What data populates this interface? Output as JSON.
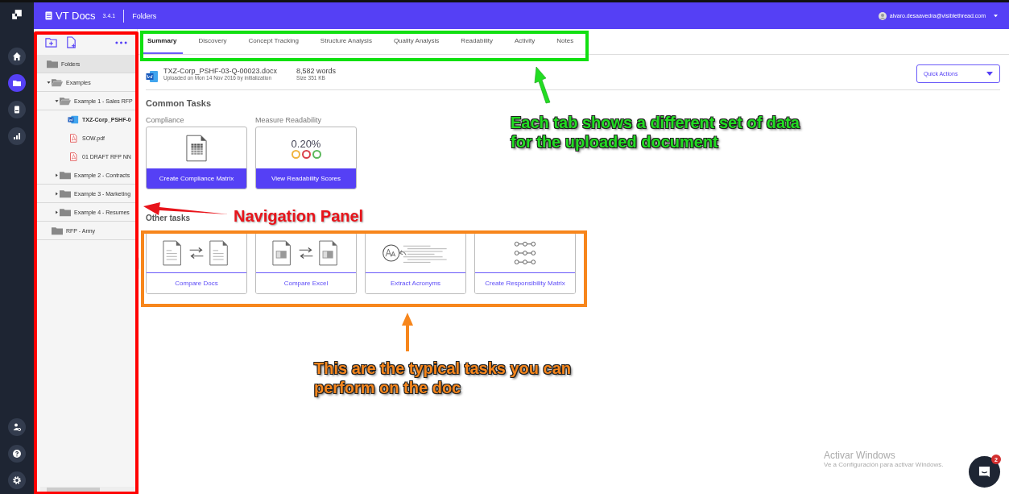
{
  "app": {
    "product": "VT Docs",
    "version": "3.4.1",
    "section": "Folders",
    "user": "alvaro.desaavedra@visiblethread.com"
  },
  "rail": {
    "items": [
      {
        "kind": "home",
        "selected": false
      },
      {
        "kind": "folder",
        "selected": true
      },
      {
        "kind": "document",
        "selected": false
      },
      {
        "kind": "chart",
        "selected": false
      }
    ],
    "bottom_items": [
      {
        "kind": "user-settings"
      },
      {
        "kind": "help"
      },
      {
        "kind": "settings"
      }
    ]
  },
  "navigation": {
    "tree": [
      {
        "kind": "folder",
        "label": "Folders",
        "selected": false,
        "children": [
          {
            "kind": "folder",
            "label": "Examples",
            "expanded": true,
            "selected": false,
            "children": [
              {
                "kind": "folder",
                "label": "Example 1 - Sales RFP",
                "expanded": true,
                "selected": false,
                "children": [
                  {
                    "kind": "word",
                    "label": "TXZ-Corp_PSHF-0",
                    "selected": true
                  },
                  {
                    "kind": "pdf",
                    "label": "SOW.pdf",
                    "selected": false
                  },
                  {
                    "kind": "pdf",
                    "label": "01 DRAFT RFP NN",
                    "selected": false
                  }
                ]
              },
              {
                "kind": "folder",
                "label": "Example 2 - Contracts",
                "expanded": false,
                "selected": false
              },
              {
                "kind": "folder",
                "label": "Example 3 - Marketing",
                "expanded": false,
                "selected": false
              },
              {
                "kind": "folder",
                "label": "Example 4 - Resumes",
                "expanded": false,
                "selected": false
              }
            ]
          },
          {
            "kind": "folder",
            "label": "RFP - Army",
            "selected": false
          }
        ]
      }
    ]
  },
  "tabs": [
    {
      "label": "Summary",
      "selected": true
    },
    {
      "label": "Discovery",
      "selected": false
    },
    {
      "label": "Concept Tracking",
      "selected": false
    },
    {
      "label": "Structure Analysis",
      "selected": false
    },
    {
      "label": "Quality Analysis",
      "selected": false
    },
    {
      "label": "Readability",
      "selected": false
    },
    {
      "label": "Activity",
      "selected": false
    },
    {
      "label": "Notes",
      "selected": false
    }
  ],
  "document": {
    "name": "TXZ-Corp_PSHF-03-Q-00023.docx",
    "uploaded": "Uploaded on Mon 14 Nov 2016 by initialization",
    "words": "8,582 words",
    "size": "Size 351 KB"
  },
  "quick_actions": {
    "label": "Quick Actions"
  },
  "common_tasks": {
    "title": "Common Tasks",
    "cards": [
      {
        "kind": "compliance",
        "caption": "Compliance",
        "button": "Create Compliance Matrix"
      },
      {
        "kind": "readability",
        "caption": "Measure Readability",
        "reading": "0.20%",
        "indicators": [
          {
            "color": "#f0b440"
          },
          {
            "color": "#d9404a"
          },
          {
            "color": "#5cb85c"
          }
        ],
        "button": "View Readability Scores"
      }
    ]
  },
  "other_tasks": {
    "title": "Other tasks",
    "cards": [
      {
        "kind": "compare-docs",
        "button": "Compare Docs"
      },
      {
        "kind": "compare-excel",
        "button": "Compare Excel"
      },
      {
        "kind": "acronyms",
        "button": "Extract Acronyms"
      },
      {
        "kind": "responsibility",
        "button": "Create Responsibility Matrix"
      }
    ]
  },
  "windows_notice": {
    "title": "Activar Windows",
    "text": "Ve a Configuración para activar Windows."
  },
  "chat": {
    "badge": "2"
  },
  "annotations": [
    {
      "kind": "navigation",
      "lines": [
        "Navigation Panel"
      ]
    },
    {
      "kind": "tabs",
      "lines": [
        "Each tab shows a different set of data",
        "for the uploaded document"
      ]
    },
    {
      "kind": "tasks",
      "lines": [
        "This are the typical tasks you can",
        "perform on the doc"
      ]
    }
  ]
}
